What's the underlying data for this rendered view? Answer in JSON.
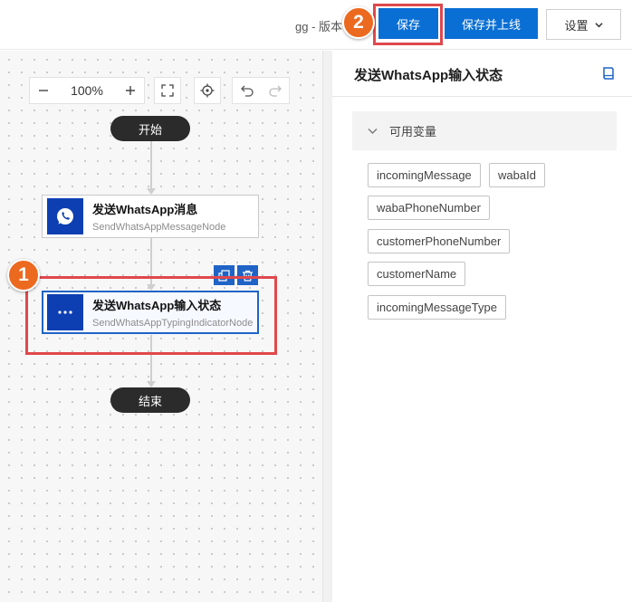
{
  "header": {
    "version_text": "gg - 版本",
    "save_label": "保存",
    "publish_label": "保存并上线",
    "settings_label": "设置"
  },
  "annotations": {
    "badge_1": "1",
    "badge_2": "2",
    "highlight_color": "#e0484c",
    "badge_color": "#ec6a20"
  },
  "toolbar": {
    "zoom_level": "100%",
    "icons": [
      "zoom-out-icon",
      "zoom-in-icon",
      "fit-view-icon",
      "locate-icon",
      "undo-icon",
      "redo-icon"
    ]
  },
  "flow": {
    "start_label": "开始",
    "end_label": "结束",
    "nodes": [
      {
        "title": "发送WhatsApp消息",
        "subtitle": "SendWhatsAppMessageNode",
        "icon": "whatsapp-icon"
      },
      {
        "title": "发送WhatsApp输入状态",
        "subtitle": "SendWhatsAppTypingIndicatorNode",
        "icon": "typing-dots-icon",
        "selected": true
      }
    ],
    "node_actions": [
      "copy-icon",
      "delete-icon"
    ]
  },
  "panel": {
    "title": "发送WhatsApp输入状态",
    "section_title": "可用变量",
    "variables": [
      "incomingMessage",
      "wabaId",
      "wabaPhoneNumber",
      "customerPhoneNumber",
      "customerName",
      "incomingMessageType"
    ]
  },
  "colors": {
    "primary": "#0a6fd4",
    "node_icon_bg": "#0d3fb3",
    "pill_bg": "#2b2b2b"
  }
}
